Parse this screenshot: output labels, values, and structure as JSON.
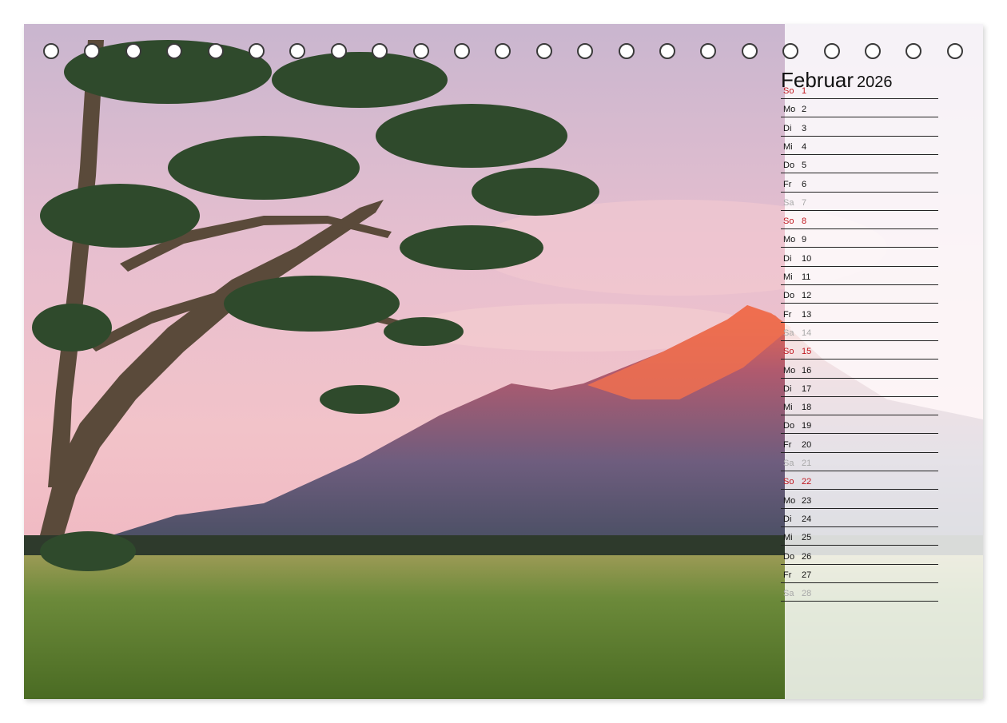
{
  "calendar": {
    "month": "Februar",
    "year": "2026",
    "days": [
      {
        "wd": "So",
        "d": "1",
        "kind": "sun"
      },
      {
        "wd": "Mo",
        "d": "2",
        "kind": "week"
      },
      {
        "wd": "Di",
        "d": "3",
        "kind": "week"
      },
      {
        "wd": "Mi",
        "d": "4",
        "kind": "week"
      },
      {
        "wd": "Do",
        "d": "5",
        "kind": "week"
      },
      {
        "wd": "Fr",
        "d": "6",
        "kind": "week"
      },
      {
        "wd": "Sa",
        "d": "7",
        "kind": "sat"
      },
      {
        "wd": "So",
        "d": "8",
        "kind": "sun"
      },
      {
        "wd": "Mo",
        "d": "9",
        "kind": "week"
      },
      {
        "wd": "Di",
        "d": "10",
        "kind": "week"
      },
      {
        "wd": "Mi",
        "d": "11",
        "kind": "week"
      },
      {
        "wd": "Do",
        "d": "12",
        "kind": "week"
      },
      {
        "wd": "Fr",
        "d": "13",
        "kind": "week"
      },
      {
        "wd": "Sa",
        "d": "14",
        "kind": "sat"
      },
      {
        "wd": "So",
        "d": "15",
        "kind": "sun"
      },
      {
        "wd": "Mo",
        "d": "16",
        "kind": "week"
      },
      {
        "wd": "Di",
        "d": "17",
        "kind": "week"
      },
      {
        "wd": "Mi",
        "d": "18",
        "kind": "week"
      },
      {
        "wd": "Do",
        "d": "19",
        "kind": "week"
      },
      {
        "wd": "Fr",
        "d": "20",
        "kind": "week"
      },
      {
        "wd": "Sa",
        "d": "21",
        "kind": "sat"
      },
      {
        "wd": "So",
        "d": "22",
        "kind": "sun"
      },
      {
        "wd": "Mo",
        "d": "23",
        "kind": "week"
      },
      {
        "wd": "Di",
        "d": "24",
        "kind": "week"
      },
      {
        "wd": "Mi",
        "d": "25",
        "kind": "week"
      },
      {
        "wd": "Do",
        "d": "26",
        "kind": "week"
      },
      {
        "wd": "Fr",
        "d": "27",
        "kind": "week"
      },
      {
        "wd": "Sa",
        "d": "28",
        "kind": "sat"
      }
    ]
  },
  "colors": {
    "sunday": "#c0181f",
    "saturday": "#a8a8a8",
    "weekday": "#111111"
  }
}
